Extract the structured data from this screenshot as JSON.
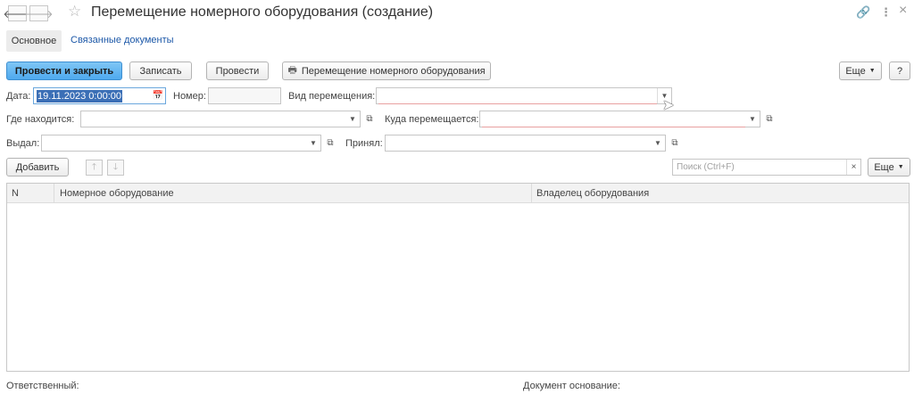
{
  "window": {
    "title": "Перемещение номерного оборудования (создание)",
    "back_glyph": "🡐",
    "forward_glyph": "🡒",
    "star_glyph": "☆",
    "link_glyph": "🔗",
    "more_glyph": "⋮",
    "close_glyph": "×"
  },
  "tabs": [
    {
      "label": "Основное",
      "active": true
    },
    {
      "label": "Связанные документы",
      "active": false
    }
  ],
  "toolbar": {
    "post_close": "Провести и закрыть",
    "save": "Записать",
    "post": "Провести",
    "print": "Перемещение номерного оборудования",
    "more": "Еще",
    "help": "?"
  },
  "form": {
    "date_label": "Дата:",
    "date_value": "19.11.2023  0:00:00",
    "number_label": "Номер:",
    "number_value": "",
    "move_type_label": "Вид перемещения:",
    "move_type_value": "",
    "location_label": "Где находится:",
    "location_value": "",
    "destination_label": "Куда перемещается:",
    "destination_value": "",
    "issued_label": "Выдал:",
    "issued_value": "",
    "received_label": "Принял:",
    "received_value": ""
  },
  "table_toolbar": {
    "add": "Добавить",
    "up_glyph": "🡑",
    "down_glyph": "🡓",
    "search_placeholder": "Поиск (Ctrl+F)",
    "clear_glyph": "×",
    "more": "Еще"
  },
  "table": {
    "columns": [
      "N",
      "Номерное оборудование",
      "Владелец оборудования"
    ],
    "rows": []
  },
  "footer": {
    "responsible_label": "Ответственный:",
    "base_document_label": "Документ основание:"
  },
  "colors": {
    "accent": "#4ea9ee",
    "link": "#1c58a8",
    "required_underline": "#e8a0a0"
  }
}
